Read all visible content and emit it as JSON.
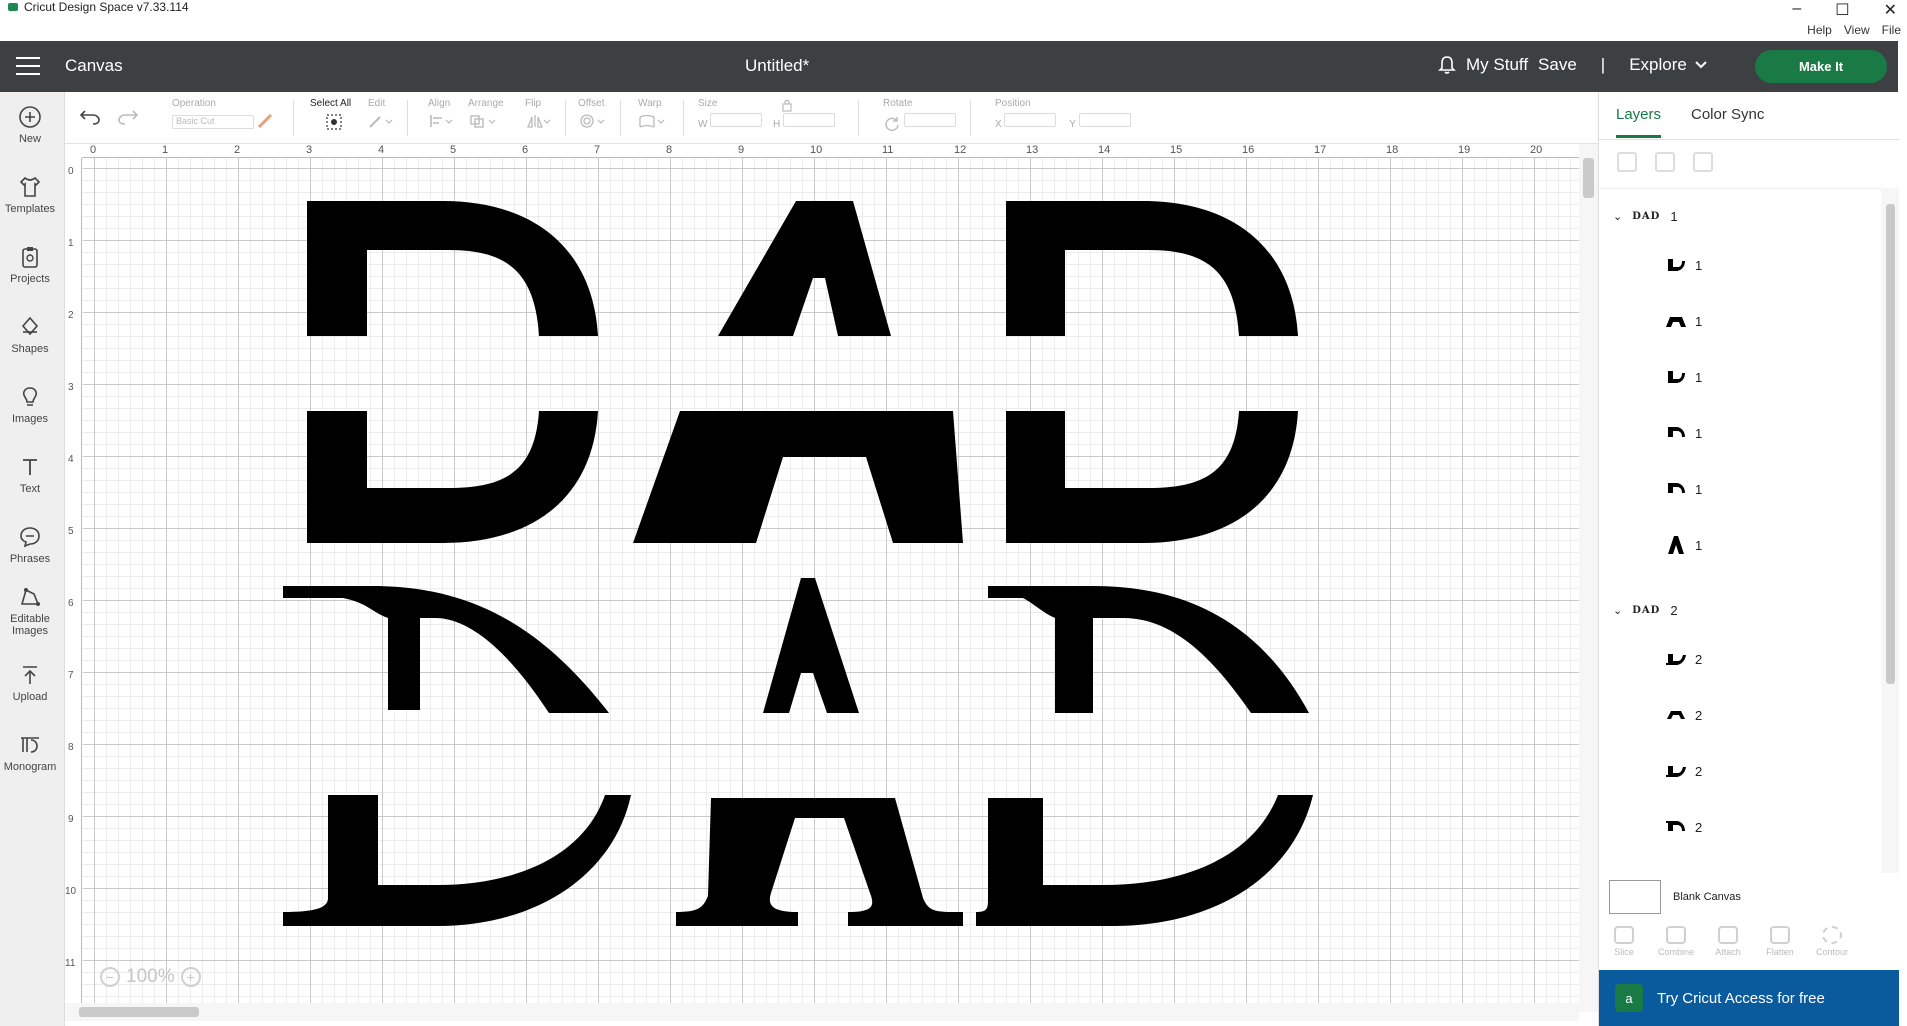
{
  "window": {
    "title": "Cricut Design Space  v7.33.114",
    "menu": [
      "Help",
      "View",
      "File"
    ],
    "controls": [
      "–",
      "☐",
      "✕"
    ]
  },
  "header": {
    "section": "Canvas",
    "doc_title": "Untitled*",
    "my_stuff": "My Stuff",
    "save": "Save",
    "separator": "|",
    "explore": "Explore",
    "make_it": "Make It"
  },
  "sidebar": {
    "items": [
      {
        "label": "New",
        "icon": "plus-circle-icon"
      },
      {
        "label": "Templates",
        "icon": "shirt-icon"
      },
      {
        "label": "Projects",
        "icon": "clipboard-icon"
      },
      {
        "label": "Shapes",
        "icon": "shapes-icon"
      },
      {
        "label": "Images",
        "icon": "bulb-icon"
      },
      {
        "label": "Text",
        "icon": "text-icon"
      },
      {
        "label": "Phrases",
        "icon": "chat-icon"
      },
      {
        "label": "Editable Images",
        "icon": "edit-image-icon"
      },
      {
        "label": "Upload",
        "icon": "upload-icon"
      },
      {
        "label": "Monogram",
        "icon": "monogram-icon"
      }
    ]
  },
  "toolbar": {
    "operation": "Operation",
    "operation_value": "Basic Cut",
    "select_all": "Select All",
    "edit": "Edit",
    "align": "Align",
    "arrange": "Arrange",
    "flip": "Flip",
    "offset": "Offset",
    "warp": "Warp",
    "size": "Size",
    "w": "W",
    "h": "H",
    "rotate": "Rotate",
    "position": "Position",
    "x": "X",
    "y": "Y"
  },
  "ruler": {
    "top": [
      "0",
      "1",
      "2",
      "3",
      "4",
      "5",
      "6",
      "7",
      "8",
      "9",
      "10",
      "11",
      "12",
      "13",
      "14",
      "15",
      "16",
      "17",
      "18",
      "19",
      "20"
    ],
    "left": [
      "0",
      "1",
      "2",
      "3",
      "4",
      "5",
      "6",
      "7",
      "8",
      "9",
      "10",
      "11"
    ]
  },
  "canvas": {
    "zoom": "100%"
  },
  "right_panel": {
    "tabs": [
      "Layers",
      "Color Sync"
    ],
    "groups": [
      {
        "name": "DAD",
        "count": "1",
        "layers": [
          "1",
          "1",
          "1",
          "1",
          "1",
          "1"
        ]
      },
      {
        "name": "DAD",
        "count": "2",
        "layers": [
          "2",
          "2",
          "2",
          "2"
        ]
      }
    ],
    "blank_canvas": "Blank Canvas",
    "bottom_tools": [
      "Slice",
      "Combine",
      "Attach",
      "Flatten",
      "Contour"
    ],
    "promo": "Try Cricut Access for free"
  }
}
